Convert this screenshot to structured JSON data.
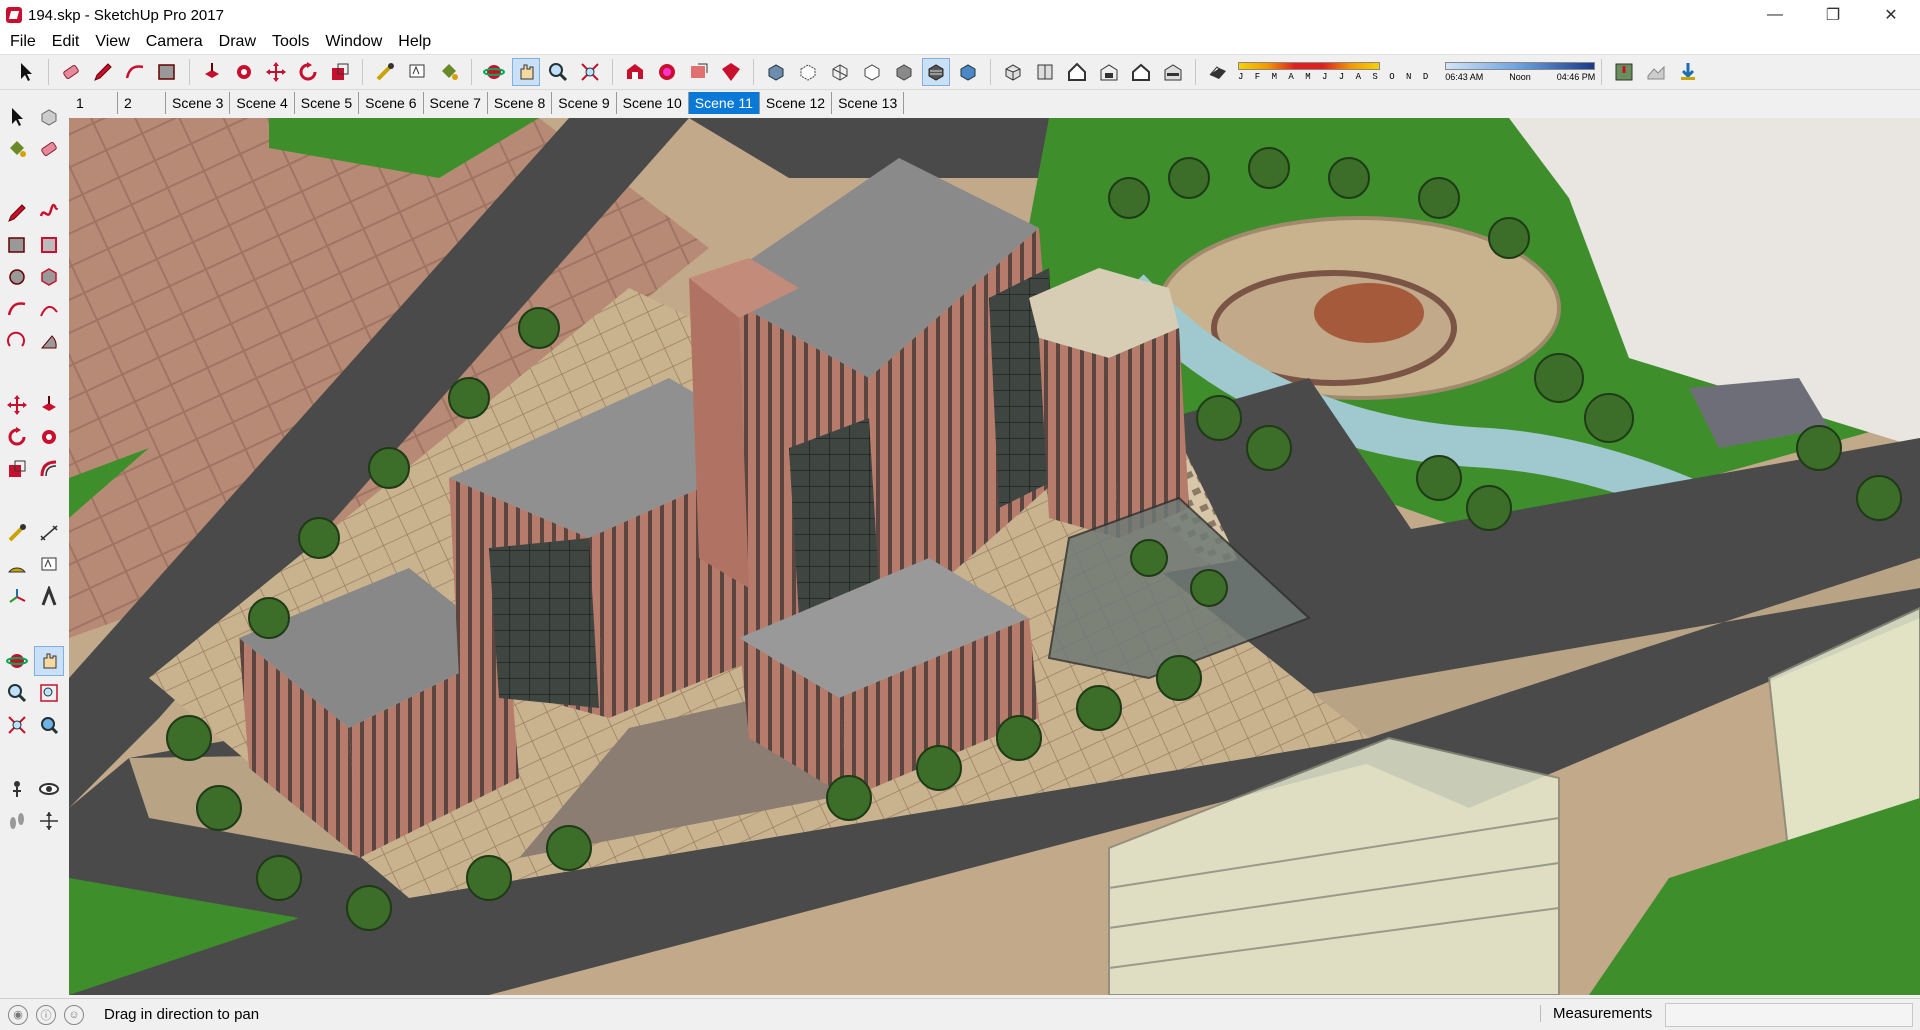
{
  "window": {
    "title": "194.skp - SketchUp Pro 2017",
    "minimize": "—",
    "restore": "❐",
    "close": "✕"
  },
  "menu": [
    "File",
    "Edit",
    "View",
    "Camera",
    "Draw",
    "Tools",
    "Window",
    "Help"
  ],
  "shadows": {
    "months": "J F M A M J J A S O N D",
    "time_start": "06:43 AM",
    "time_mid": "Noon",
    "time_end": "04:46 PM"
  },
  "scenes": {
    "tabs": [
      "1",
      "2",
      "Scene 3",
      "Scene 4",
      "Scene 5",
      "Scene 6",
      "Scene 7",
      "Scene 8",
      "Scene 9",
      "Scene 10",
      "Scene 11",
      "Scene 12",
      "Scene 13"
    ],
    "active": "Scene 11"
  },
  "status": {
    "hint": "Drag in direction to pan",
    "measurements_label": "Measurements",
    "measurements_value": ""
  },
  "colors": {
    "accent": "#0a78d7",
    "brick": "#b67b6a",
    "road": "#4a4a4a",
    "grass": "#3e8f2c",
    "roof": "#8e8e8e"
  }
}
